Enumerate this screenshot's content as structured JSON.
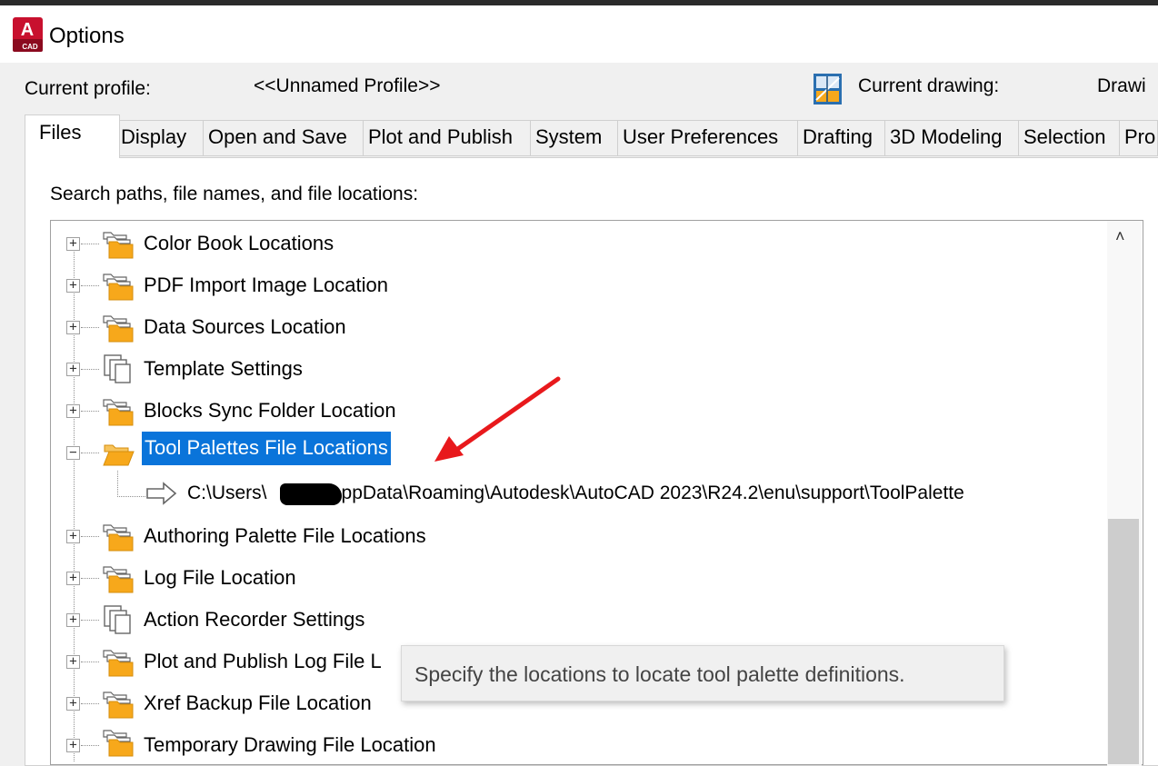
{
  "window": {
    "title": "Options",
    "app_icon": "autocad-app-icon",
    "app_icon_text": "CAD",
    "app_icon_letter": "A"
  },
  "profile": {
    "current_profile_label": "Current profile:",
    "current_profile_value": "<<Unnamed Profile>>",
    "current_drawing_label": "Current drawing:",
    "current_drawing_value": "Drawi"
  },
  "tabs": [
    {
      "label": "Files",
      "active": true
    },
    {
      "label": "Display"
    },
    {
      "label": "Open and Save"
    },
    {
      "label": "Plot and Publish"
    },
    {
      "label": "System"
    },
    {
      "label": "User Preferences"
    },
    {
      "label": "Drafting"
    },
    {
      "label": "3D Modeling"
    },
    {
      "label": "Selection"
    },
    {
      "label": "Pro"
    }
  ],
  "files": {
    "search_label": "Search paths, file names, and file locations:",
    "tree": [
      {
        "label": "Color Book Locations",
        "icon": "folder-stack-icon",
        "expanded": false
      },
      {
        "label": "PDF Import Image Location",
        "icon": "folder-stack-icon",
        "expanded": false
      },
      {
        "label": "Data Sources Location",
        "icon": "folder-stack-icon",
        "expanded": false
      },
      {
        "label": "Template Settings",
        "icon": "copy-settings-icon",
        "expanded": false
      },
      {
        "label": "Blocks Sync Folder Location",
        "icon": "folder-stack-icon",
        "expanded": false
      },
      {
        "label": "Tool Palettes File Locations",
        "icon": "open-folder-icon",
        "expanded": true,
        "selected": true,
        "children": [
          {
            "path": "C:\\Users\\",
            "path_rest": "AppData\\Roaming\\Autodesk\\AutoCAD 2023\\R24.2\\enu\\support\\ToolPalette",
            "icon": "arrow-right-icon"
          }
        ]
      },
      {
        "label": "Authoring Palette File Locations",
        "icon": "folder-stack-icon",
        "expanded": false
      },
      {
        "label": "Log File Location",
        "icon": "folder-stack-icon",
        "expanded": false
      },
      {
        "label": "Action Recorder Settings",
        "icon": "copy-settings-icon",
        "expanded": false
      },
      {
        "label": "Plot and Publish Log File L",
        "icon": "folder-stack-icon",
        "expanded": false
      },
      {
        "label": "Xref Backup File Location",
        "icon": "folder-stack-icon",
        "expanded": false
      },
      {
        "label": "Temporary Drawing File Location",
        "icon": "folder-stack-icon",
        "expanded": false
      }
    ],
    "tooltip": "Specify the locations to locate tool palette definitions."
  },
  "colors": {
    "selection": "#0a74da",
    "folder": "#f7a81b",
    "annotation_arrow": "#e8191c"
  }
}
